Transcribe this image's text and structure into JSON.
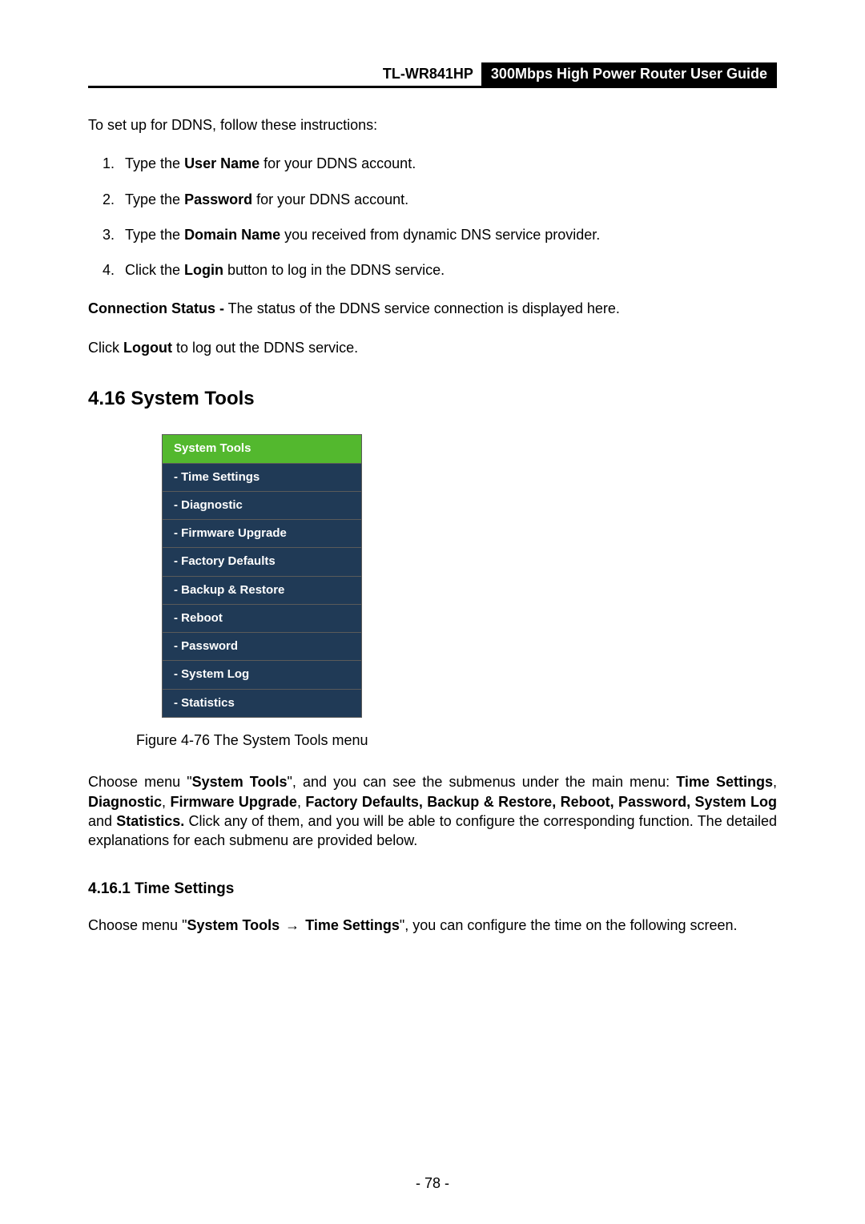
{
  "header": {
    "model": "TL-WR841HP",
    "title": "300Mbps High Power Router User Guide"
  },
  "intro": "To set up for DDNS, follow these instructions:",
  "steps": [
    {
      "prefix": "Type the ",
      "bold": "User Name",
      "suffix": " for your DDNS account."
    },
    {
      "prefix": "Type the ",
      "bold": "Password",
      "suffix": " for your DDNS account."
    },
    {
      "prefix": "Type the ",
      "bold": "Domain Name",
      "suffix": " you received from dynamic DNS service provider."
    },
    {
      "prefix": "Click the ",
      "bold": "Login",
      "suffix": " button to log in the DDNS service."
    }
  ],
  "conn_status_bold": "Connection Status -",
  "conn_status_rest": " The status of the DDNS service connection is displayed here.",
  "logout_line_pre": "Click ",
  "logout_bold": "Logout",
  "logout_line_post": " to log out the DDNS service.",
  "section_heading": "4.16  System Tools",
  "menu": {
    "title": "System Tools",
    "items": [
      "- Time Settings",
      "- Diagnostic",
      "- Firmware Upgrade",
      "- Factory Defaults",
      "- Backup & Restore",
      "- Reboot",
      "- Password",
      "- System Log",
      "- Statistics"
    ]
  },
  "figure_caption": "Figure 4-76 The System Tools menu",
  "choose_para": {
    "p1": "Choose menu \"",
    "b1": "System Tools",
    "p2": "\", and you can see the submenus under the main menu: ",
    "b2": "Time Settings",
    "c1": ", ",
    "b3": "Diagnostic",
    "c2": ", ",
    "b4": "Firmware Upgrade",
    "c3": ", ",
    "b5": "Factory Defaults, Backup & Restore, Reboot, Password, System Log",
    "p3": " and ",
    "b6": "Statistics.",
    "p4": " Click any of them, and you will be able to configure the corresponding function. The detailed explanations for each submenu are provided below."
  },
  "subsection_heading": "4.16.1 Time Settings",
  "time_para": {
    "p1": "Choose menu \"",
    "b1": "System Tools",
    "arrow": " → ",
    "b2": "Time Settings",
    "p2": "\", you can configure the time on the following screen."
  },
  "page_number": "- 78 -"
}
